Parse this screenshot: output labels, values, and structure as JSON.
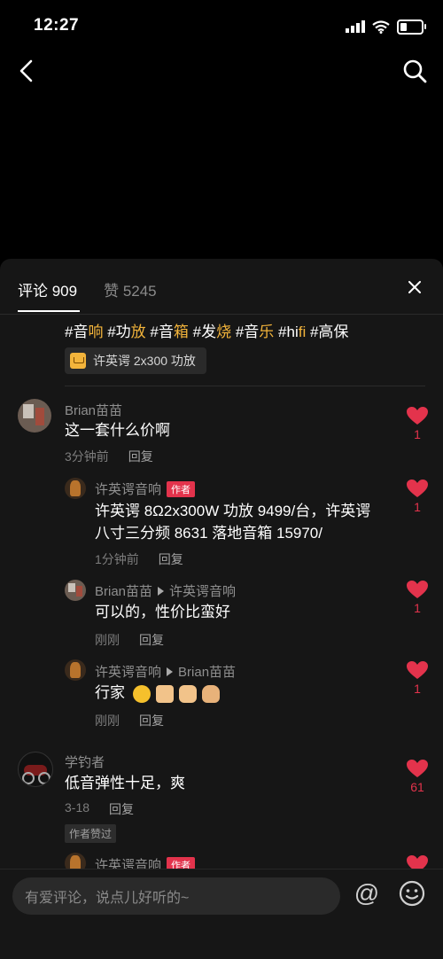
{
  "status": {
    "time": "12:27"
  },
  "sheet": {
    "tab_comments": "评论 909",
    "tab_likes": "赞 5245",
    "tags": [
      {
        "hash": "#",
        "a": "音",
        "b": "响"
      },
      {
        "hash": "#",
        "a": "功",
        "b": "放"
      },
      {
        "hash": "#",
        "a": "音",
        "b": "箱"
      },
      {
        "hash": "#",
        "a": "发",
        "b": "烧"
      },
      {
        "hash": "#",
        "a": "音",
        "b": "乐"
      },
      {
        "hash": "#",
        "a": "hi",
        "b": "fi"
      },
      {
        "hash": "#",
        "a": "高保",
        "b": ""
      }
    ],
    "product": "许英谔 2x300 功放"
  },
  "comments": [
    {
      "name": "Brian苗苗",
      "text": "这一套什么价啊",
      "time": "3分钟前",
      "reply": "回复",
      "likes": "1"
    },
    {
      "name": "许英谔音响",
      "badge": "作者",
      "text_line1": "许英谔 8Ω2x300W 功放 9499/台，许英谔",
      "text_line2": "八寸三分频 8631 落地音箱 15970/",
      "time": "1分钟前",
      "reply": "回复",
      "likes": "1"
    },
    {
      "name": "Brian苗苗",
      "reply_to": "许英谔音响",
      "text": "可以的，性价比蛮好",
      "time": "刚刚",
      "reply": "回复",
      "likes": "1"
    },
    {
      "name": "许英谔音响",
      "reply_to": "Brian苗苗",
      "text": "行家",
      "time": "刚刚",
      "reply": "回复",
      "likes": "1"
    },
    {
      "name": "学钓者",
      "text": "低音弹性十足，爽",
      "time": "3-18",
      "reply": "回复",
      "likes": "61",
      "liked_by_author": "作者赞过"
    },
    {
      "name": "许英谔音响",
      "badge": "作者"
    }
  ],
  "input": {
    "placeholder": "有爱评论，说点儿好听的~"
  },
  "icons": {
    "back": "chevron-left-icon",
    "search": "search-icon",
    "close": "close-icon",
    "heart": "heart-icon",
    "at": "at-icon",
    "emoji": "smiley-icon"
  },
  "colors": {
    "accent": "#f3b43b",
    "like": "#e3334c"
  }
}
